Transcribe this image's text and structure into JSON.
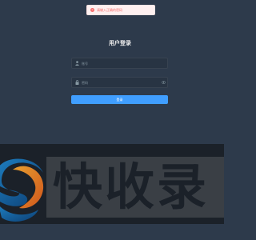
{
  "toast": {
    "message": "请输入正确的密码"
  },
  "login": {
    "title": "用户登录",
    "username_placeholder": "账号",
    "password_placeholder": "密码",
    "submit_label": "登录"
  },
  "watermark": {
    "brand_text": "快收录"
  },
  "icons": {
    "toast": "error-icon",
    "user": "user-icon",
    "password": "lock-icon",
    "toggle": "eye-icon"
  },
  "colors": {
    "background": "#2d3a4b",
    "accent": "#409eff",
    "error": "#f56c6c"
  }
}
